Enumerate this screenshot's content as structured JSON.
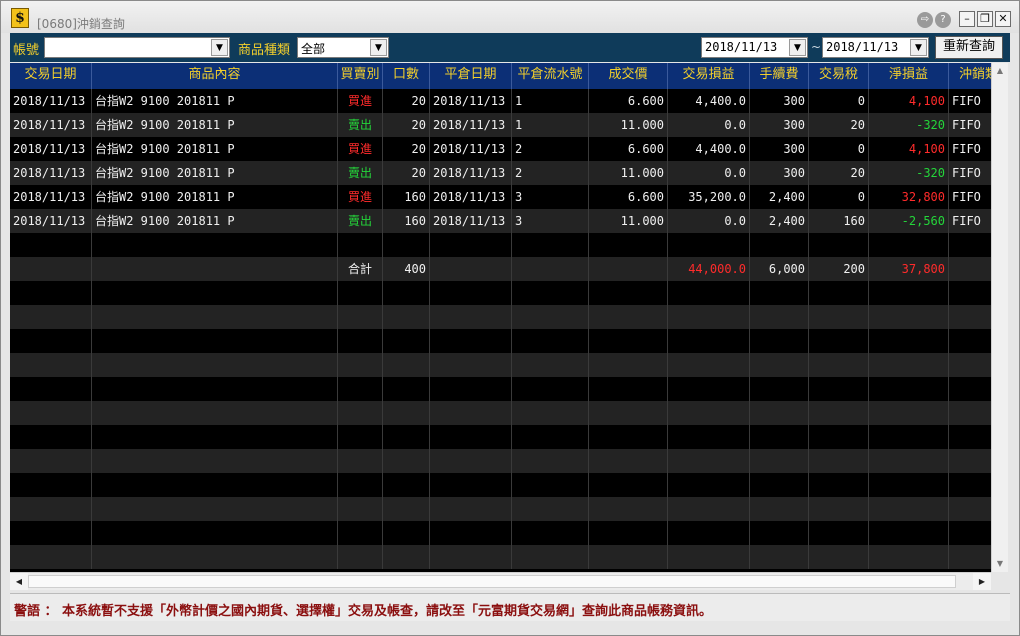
{
  "window": {
    "title": "[0680]沖銷查詢",
    "app_icon": "$"
  },
  "toolbar": {
    "account_label": "帳號",
    "account_value": "",
    "product_type_label": "商品種類",
    "product_type_value": "全部",
    "date_from": "2018/11/13",
    "date_sep": "~",
    "date_to": "2018/11/13",
    "requery_label": "重新查詢"
  },
  "table": {
    "columns": [
      "交易日期",
      "商品內容",
      "買賣別",
      "口數",
      "平倉日期",
      "平倉流水號",
      "成交價",
      "交易損益",
      "手續費",
      "交易稅",
      "淨損益",
      "沖銷類"
    ],
    "rows": [
      {
        "date": "2018/11/13",
        "product": "台指W2  9100  201811  P",
        "side": "買進",
        "qty": "20",
        "close_date": "2018/11/13",
        "serial": "1",
        "price": "6.600",
        "pnl": "4,400.0",
        "fee": "300",
        "tax": "0",
        "net": "4,100",
        "method": "FIFO"
      },
      {
        "date": "2018/11/13",
        "product": "台指W2  9100  201811  P",
        "side": "賣出",
        "qty": "20",
        "close_date": "2018/11/13",
        "serial": "1",
        "price": "11.000",
        "pnl": "0.0",
        "fee": "300",
        "tax": "20",
        "net": "-320",
        "method": "FIFO"
      },
      {
        "date": "2018/11/13",
        "product": "台指W2  9100  201811  P",
        "side": "買進",
        "qty": "20",
        "close_date": "2018/11/13",
        "serial": "2",
        "price": "6.600",
        "pnl": "4,400.0",
        "fee": "300",
        "tax": "0",
        "net": "4,100",
        "method": "FIFO"
      },
      {
        "date": "2018/11/13",
        "product": "台指W2  9100  201811  P",
        "side": "賣出",
        "qty": "20",
        "close_date": "2018/11/13",
        "serial": "2",
        "price": "11.000",
        "pnl": "0.0",
        "fee": "300",
        "tax": "20",
        "net": "-320",
        "method": "FIFO"
      },
      {
        "date": "2018/11/13",
        "product": "台指W2  9100  201811  P",
        "side": "買進",
        "qty": "160",
        "close_date": "2018/11/13",
        "serial": "3",
        "price": "6.600",
        "pnl": "35,200.0",
        "fee": "2,400",
        "tax": "0",
        "net": "32,800",
        "method": "FIFO"
      },
      {
        "date": "2018/11/13",
        "product": "台指W2  9100  201811  P",
        "side": "賣出",
        "qty": "160",
        "close_date": "2018/11/13",
        "serial": "3",
        "price": "11.000",
        "pnl": "0.0",
        "fee": "2,400",
        "tax": "160",
        "net": "-2,560",
        "method": "FIFO"
      }
    ],
    "totals": {
      "label": "合計",
      "qty": "400",
      "pnl": "44,000.0",
      "fee": "6,000",
      "tax": "200",
      "net": "37,800"
    }
  },
  "warning": "警語 ： 本系統暫不支援「外幣計價之國內期貨、選擇權」交易及帳查，請改至「元富期貨交易網」查詢此商品帳務資訊。",
  "colors": {
    "header_bg": "#0c2f76",
    "header_text": "#f2cf2c",
    "buy": "#ff2b2b",
    "sell": "#24d53a",
    "toolbar_bg": "#0f3b5a",
    "warning_text": "#8b0f0f"
  }
}
